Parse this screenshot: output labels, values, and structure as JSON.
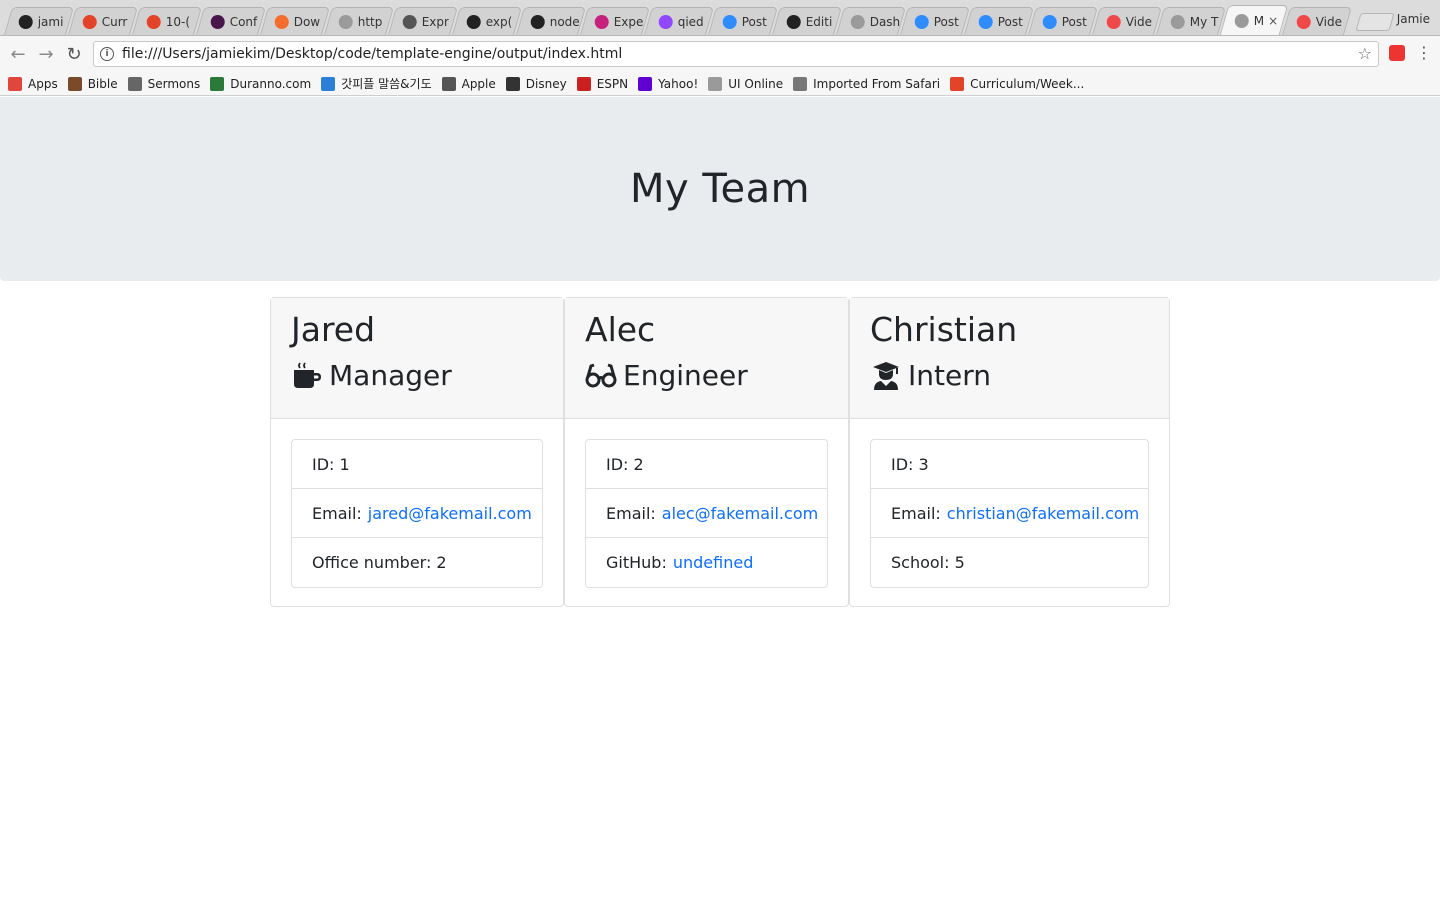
{
  "browser": {
    "tabs": [
      {
        "label": "jami",
        "icon": "github-icon",
        "color": "#222222"
      },
      {
        "label": "Curr",
        "icon": "gitlab-icon",
        "color": "#e24329"
      },
      {
        "label": "10-(",
        "icon": "gitlab-icon",
        "color": "#e24329"
      },
      {
        "label": "Conf",
        "icon": "slack-icon",
        "color": "#4a154b"
      },
      {
        "label": "Dow",
        "icon": "download-icon",
        "color": "#f56c2d"
      },
      {
        "label": "http",
        "icon": "page-icon",
        "color": "#9a9a9a"
      },
      {
        "label": "Expr",
        "icon": "express-icon",
        "color": "#555555"
      },
      {
        "label": "exp(",
        "icon": "github-icon",
        "color": "#222222"
      },
      {
        "label": "node",
        "icon": "github-icon",
        "color": "#222222"
      },
      {
        "label": "Expe",
        "icon": "express-icon",
        "color": "#c6217d"
      },
      {
        "label": "qied",
        "icon": "twitch-icon",
        "color": "#9146ff"
      },
      {
        "label": "Post",
        "icon": "zoom-icon",
        "color": "#2d8cff"
      },
      {
        "label": "Editi",
        "icon": "github-icon",
        "color": "#222222"
      },
      {
        "label": "Dash",
        "icon": "page-icon",
        "color": "#9a9a9a"
      },
      {
        "label": "Post",
        "icon": "zoom-icon",
        "color": "#2d8cff"
      },
      {
        "label": "Post",
        "icon": "zoom-icon",
        "color": "#2d8cff"
      },
      {
        "label": "Post",
        "icon": "zoom-icon",
        "color": "#2d8cff"
      },
      {
        "label": "Vide",
        "icon": "video-icon",
        "color": "#f04848"
      },
      {
        "label": "My T",
        "icon": "page-icon",
        "color": "#9a9a9a"
      },
      {
        "label": "M",
        "icon": "page-icon",
        "color": "#9a9a9a",
        "active": true
      },
      {
        "label": "Vide",
        "icon": "video-icon",
        "color": "#f04848"
      }
    ],
    "profile_name": "Jamie",
    "url": "file:///Users/jamiekim/Desktop/code/template-engine/output/index.html",
    "bookmarks": [
      {
        "label": "Apps",
        "icon": "apps-grid-icon",
        "color": "#e0463b"
      },
      {
        "label": "Bible",
        "icon": "bible-icon",
        "color": "#7a4a2a"
      },
      {
        "label": "Sermons",
        "icon": "sermons-icon",
        "color": "#666666"
      },
      {
        "label": "Duranno.com",
        "icon": "duranno-icon",
        "color": "#2a7a3a"
      },
      {
        "label": "갓피플 말씀&기도",
        "icon": "godpeople-icon",
        "color": "#2b7fd6"
      },
      {
        "label": "Apple",
        "icon": "apple-icon",
        "color": "#555555"
      },
      {
        "label": "Disney",
        "icon": "disney-icon",
        "color": "#333333"
      },
      {
        "label": "ESPN",
        "icon": "espn-icon",
        "color": "#cc1f1f"
      },
      {
        "label": "Yahoo!",
        "icon": "yahoo-icon",
        "color": "#5f01d1"
      },
      {
        "label": "UI Online",
        "icon": "page-icon",
        "color": "#9a9a9a"
      },
      {
        "label": "Imported From Safari",
        "icon": "folder-icon",
        "color": "#777777"
      },
      {
        "label": "Curriculum/Week...",
        "icon": "gitlab-icon",
        "color": "#e24329"
      }
    ]
  },
  "page": {
    "title": "My Team",
    "link_color": "#0d6efd",
    "employees": [
      {
        "name": "Jared",
        "role": "Manager",
        "role_icon": "coffee-mug-icon",
        "id_label": "ID: 1",
        "email_label": "Email:",
        "email": "jared@fakemail.com",
        "extra_label": "Office number: 2",
        "extra_link": ""
      },
      {
        "name": "Alec",
        "role": "Engineer",
        "role_icon": "glasses-icon",
        "id_label": "ID: 2",
        "email_label": "Email:",
        "email": "alec@fakemail.com",
        "extra_label": "GitHub:",
        "extra_link": "undefined"
      },
      {
        "name": "Christian",
        "role": "Intern",
        "role_icon": "graduate-icon",
        "id_label": "ID: 3",
        "email_label": "Email:",
        "email": "christian@fakemail.com",
        "extra_label": "School: 5",
        "extra_link": ""
      }
    ]
  }
}
